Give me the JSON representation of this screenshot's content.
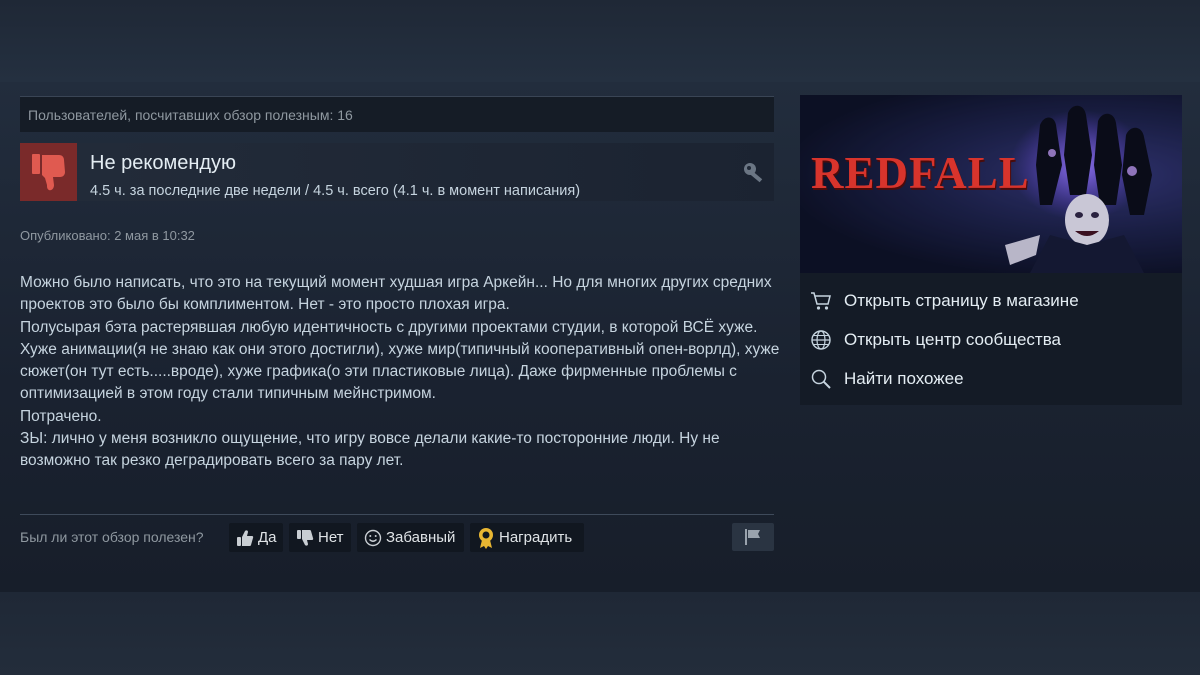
{
  "review": {
    "helpful_count_text": "Пользователей, посчитавших обзор полезным: 16",
    "verdict": "Не рекомендую",
    "hours": "4.5 ч. за последние две недели / 4.5 ч. всего (4.1 ч. в момент написания)",
    "posted": "Опубликовано: 2 мая в 10:32",
    "body": [
      "Можно было написать, что это на текущий момент худшая игра Аркейн... Но для многих других средних проектов это было бы комплиментом. Нет - это просто плохая игра.",
      "Полусырая бэта растерявшая любую идентичность с другими проектами студии, в которой ВСЁ хуже. Хуже анимации(я не знаю как они этого достигли), хуже мир(типичный кооперативный опен-ворлд), хуже сюжет(он тут есть.....вроде), хуже графика(о эти пластиковые лица). Даже фирменные проблемы с оптимизацией в этом году стали типичным мейнстримом.",
      "Потрачено.",
      "ЗЫ: лично у меня возникло ощущение, что игру вовсе делали какие-то посторонние люди. Ну не возможно так резко деградировать всего за пару лет."
    ],
    "vote": {
      "question": "Был ли этот обзор полезен?",
      "yes": "Да",
      "no": "Нет",
      "funny": "Забавный",
      "award": "Наградить"
    }
  },
  "game": {
    "logo_text": "REDFALL",
    "links": {
      "store": "Открыть страницу в магазине",
      "hub": "Открыть центр сообщества",
      "similar": "Найти похожее"
    }
  },
  "icons": [
    "thumbs-down-icon",
    "key-icon",
    "thumbs-up-icon",
    "smiley-icon",
    "award-icon",
    "flag-icon",
    "cart-icon",
    "globe-icon",
    "search-icon"
  ],
  "colors": {
    "negative_bg": "#7a2a2a",
    "logo_red": "#d8342c",
    "award_gold": "#e8b632"
  }
}
